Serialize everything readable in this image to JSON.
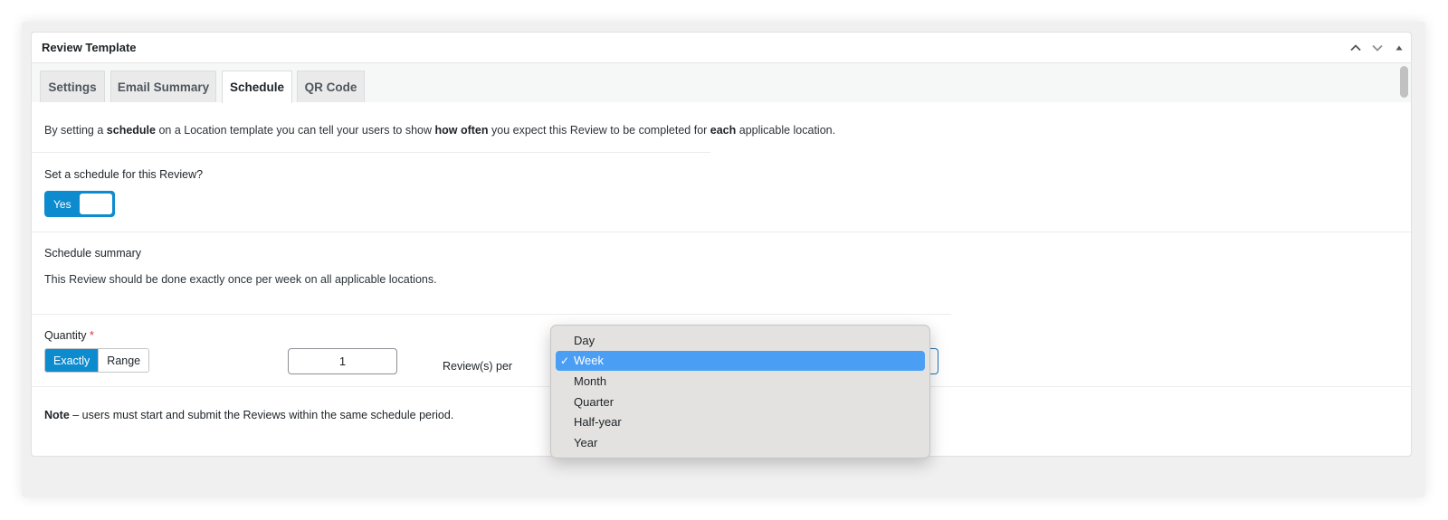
{
  "panel": {
    "title": "Review Template",
    "controls": [
      "chevron-up-icon",
      "chevron-down-icon",
      "triangle-up-icon"
    ]
  },
  "tabs": [
    {
      "label": "Settings",
      "active": false
    },
    {
      "label": "Email Summary",
      "active": false
    },
    {
      "label": "Schedule",
      "active": true
    },
    {
      "label": "QR Code",
      "active": false
    }
  ],
  "intro": {
    "p1": "By setting a ",
    "b1": "schedule",
    "p2": " on a Location template you can tell your users to show ",
    "b2": "how often",
    "p3": " you expect this Review to be completed for ",
    "b3": "each",
    "p4": " applicable location."
  },
  "schedule_toggle": {
    "question": "Set a schedule for this Review?",
    "value": "Yes"
  },
  "summary": {
    "heading": "Schedule summary",
    "text": "This Review should be done exactly once per week on all applicable locations."
  },
  "quantity": {
    "label": "Quantity",
    "required_mark": "*",
    "modes": [
      {
        "label": "Exactly",
        "selected": true
      },
      {
        "label": "Range",
        "selected": false
      }
    ],
    "value": "1",
    "per_label": "Review(s) per"
  },
  "period_dropdown": {
    "selected": "Week",
    "options": [
      "Day",
      "Week",
      "Month",
      "Quarter",
      "Half-year",
      "Year"
    ]
  },
  "note": {
    "bold": "Note",
    "text": " – users must start and submit the Reviews within the same schedule period."
  },
  "colors": {
    "accent": "#0d8bcf",
    "menu_highlight": "#4a9ff5",
    "required": "#d63638"
  }
}
